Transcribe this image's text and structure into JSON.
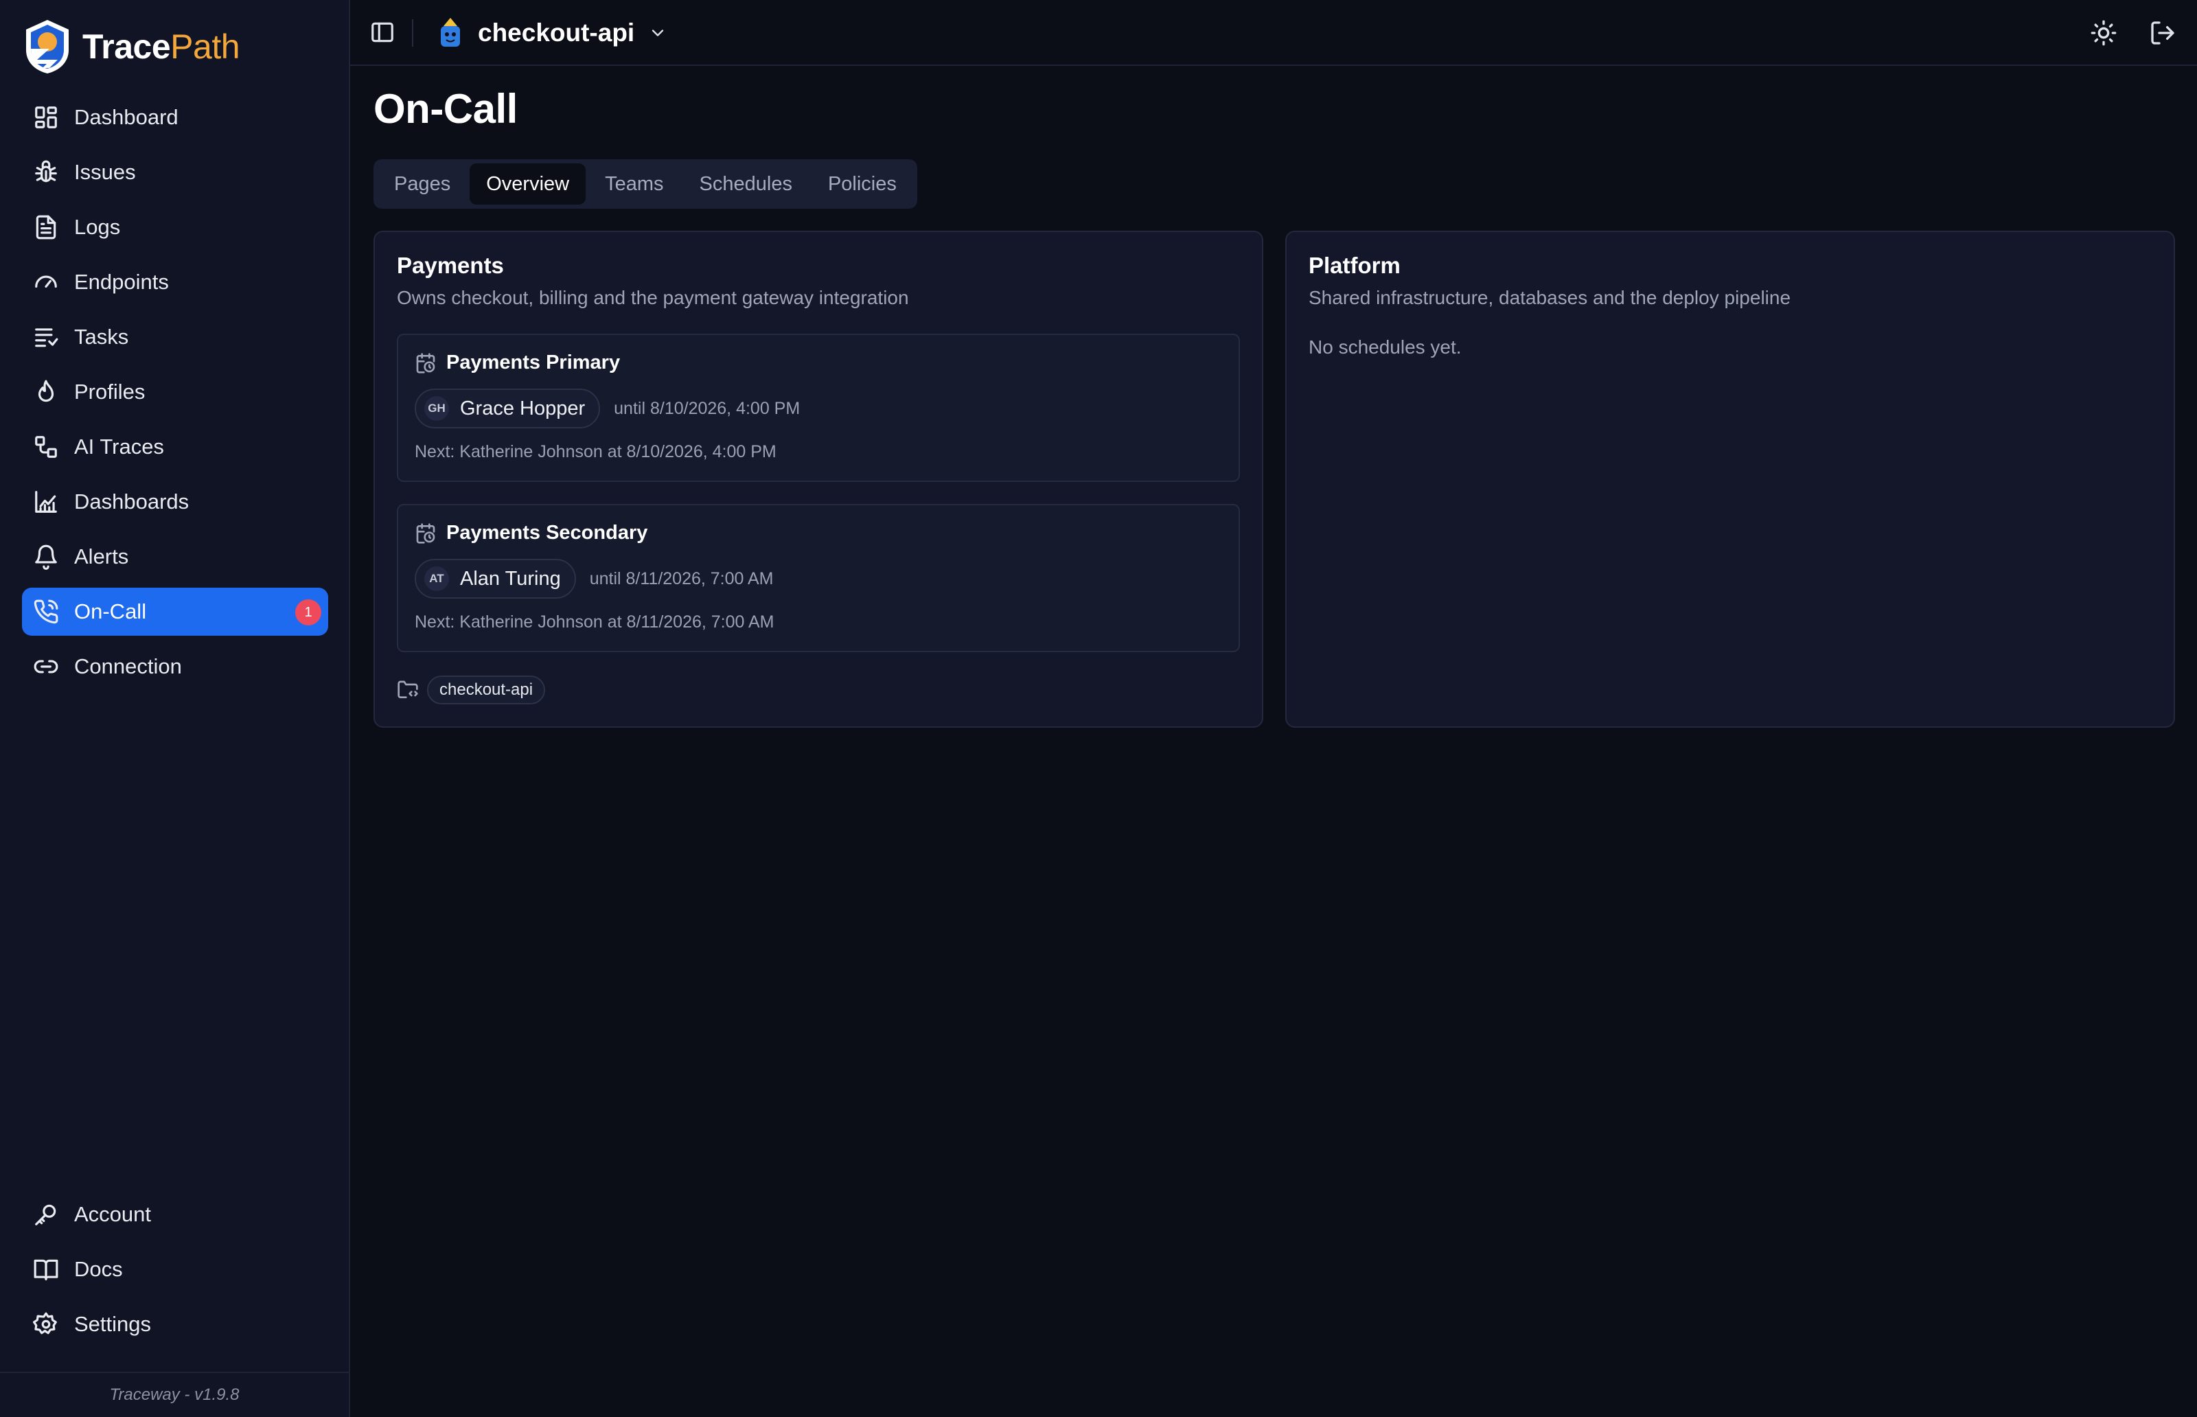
{
  "brand": {
    "name_part1": "Trace",
    "name_part2": "Path"
  },
  "sidebar": {
    "items": [
      {
        "label": "Dashboard",
        "icon": "layout-grid-icon"
      },
      {
        "label": "Issues",
        "icon": "bug-icon"
      },
      {
        "label": "Logs",
        "icon": "file-text-icon"
      },
      {
        "label": "Endpoints",
        "icon": "gauge-icon"
      },
      {
        "label": "Tasks",
        "icon": "list-icon"
      },
      {
        "label": "Profiles",
        "icon": "flame-icon"
      },
      {
        "label": "AI Traces",
        "icon": "workflow-icon"
      },
      {
        "label": "Dashboards",
        "icon": "chart-icon"
      },
      {
        "label": "Alerts",
        "icon": "bell-icon"
      },
      {
        "label": "On-Call",
        "icon": "phone-icon",
        "active": true,
        "badge": "1"
      },
      {
        "label": "Connection",
        "icon": "link-icon"
      }
    ],
    "bottom_items": [
      {
        "label": "Account",
        "icon": "key-icon"
      },
      {
        "label": "Docs",
        "icon": "book-icon"
      },
      {
        "label": "Settings",
        "icon": "gear-icon"
      }
    ],
    "footer": "Traceway - v1.9.8"
  },
  "topbar": {
    "project_name": "checkout-api"
  },
  "main": {
    "title": "On-Call",
    "tabs": [
      {
        "label": "Pages"
      },
      {
        "label": "Overview",
        "active": true
      },
      {
        "label": "Teams"
      },
      {
        "label": "Schedules"
      },
      {
        "label": "Policies"
      }
    ],
    "teams": [
      {
        "name": "Payments",
        "description": "Owns checkout, billing and the payment gateway integration",
        "schedules": [
          {
            "name": "Payments Primary",
            "oncall_initials": "GH",
            "oncall_name": "Grace Hopper",
            "until": "until 8/10/2026, 4:00 PM",
            "next": "Next: Katherine Johnson at 8/10/2026, 4:00 PM"
          },
          {
            "name": "Payments Secondary",
            "oncall_initials": "AT",
            "oncall_name": "Alan Turing",
            "until": "until 8/11/2026, 7:00 AM",
            "next": "Next: Katherine Johnson at 8/11/2026, 7:00 AM"
          }
        ],
        "project": "checkout-api"
      },
      {
        "name": "Platform",
        "description": "Shared infrastructure, databases and the deploy pipeline",
        "empty": "No schedules yet."
      }
    ]
  },
  "colors": {
    "accent": "#1f6bf0",
    "badge": "#ef4a5c",
    "brand_orange": "#f4a83c",
    "background": "#0b0d17"
  }
}
